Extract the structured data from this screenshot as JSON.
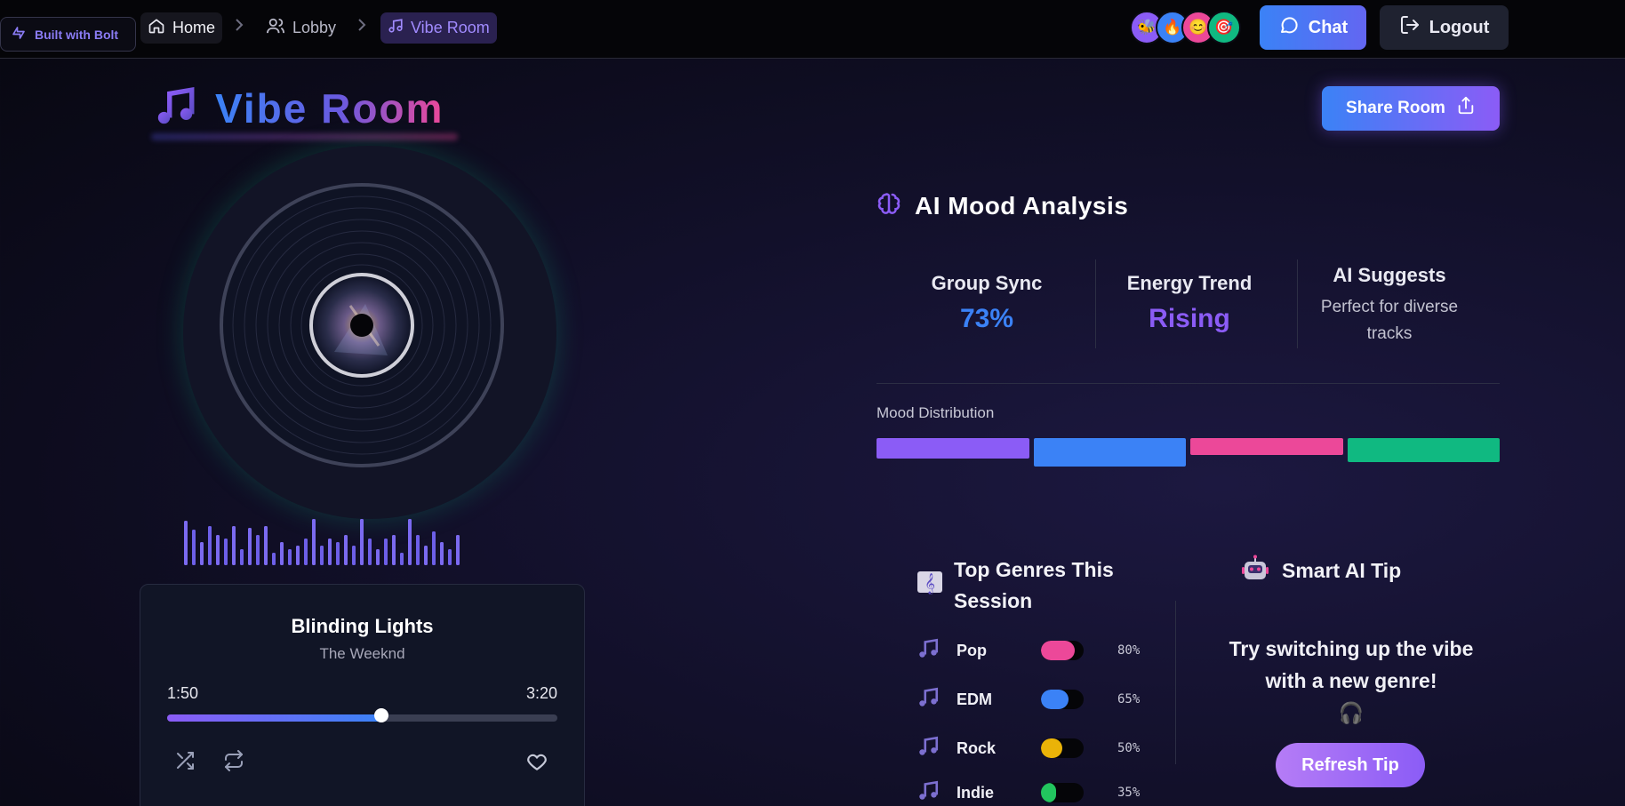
{
  "nav": {
    "badge": "Built with Bolt",
    "breadcrumbs": [
      {
        "label": "Home"
      },
      {
        "label": "Lobby"
      },
      {
        "label": "Vibe Room"
      }
    ],
    "separator": ">",
    "avatars": [
      "🐝",
      "🔥",
      "😊",
      "🎯"
    ],
    "avatar_colors": [
      "#8b5cf6",
      "#3b82f6",
      "#ec4899",
      "#10b981"
    ],
    "chat_label": "Chat",
    "logout_label": "Logout"
  },
  "page": {
    "title": "Vibe Room",
    "share_label": "Share Room"
  },
  "player": {
    "song_title": "Blinding Lights",
    "artist": "The Weeknd",
    "elapsed": "1:50",
    "duration": "3:20",
    "progress": 0.55
  },
  "mood": {
    "title": "AI Mood Analysis",
    "group_sync_label": "Group Sync",
    "group_sync_value": "73%",
    "energy_label": "Energy Trend",
    "energy_value": "Rising",
    "suggest_label": "AI Suggests",
    "suggest_value": "Perfect for diverse tracks",
    "distribution_label": "Mood Distribution",
    "distribution": [
      {
        "color": "#8b5cf6",
        "level": 0.6
      },
      {
        "color": "#3b82f6",
        "level": 1.0
      },
      {
        "color": "#ec4899",
        "level": 0.4
      },
      {
        "color": "#10b981",
        "level": 0.75
      }
    ]
  },
  "genres": {
    "title": "Top Genres This Session",
    "items": [
      {
        "name": "Pop",
        "pct": "80%",
        "value": 0.8,
        "color": "#ec4899"
      },
      {
        "name": "EDM",
        "pct": "65%",
        "value": 0.65,
        "color": "#3b82f6"
      },
      {
        "name": "Rock",
        "pct": "50%",
        "value": 0.5,
        "color": "#eab308"
      },
      {
        "name": "Indie",
        "pct": "35%",
        "value": 0.35,
        "color": "#22c55e"
      }
    ]
  },
  "tip": {
    "title": "Smart AI Tip",
    "body": "Try switching up the vibe with a new genre!",
    "emoji": "🎧",
    "refresh_label": "Refresh Tip"
  },
  "colors": {
    "accent_purple": "#8b5cf6",
    "accent_blue": "#3b82f6",
    "accent_pink": "#ec4899"
  },
  "icons": {
    "bolt": "bolt-icon",
    "home": "home-icon",
    "users": "users-icon",
    "music": "music-note-icon",
    "chat": "chat-bubble-icon",
    "logout": "logout-icon",
    "share": "share-icon",
    "brain": "brain-icon",
    "robot": "robot-icon",
    "shuffle": "shuffle-icon",
    "repeat": "repeat-icon",
    "heart": "heart-icon"
  }
}
